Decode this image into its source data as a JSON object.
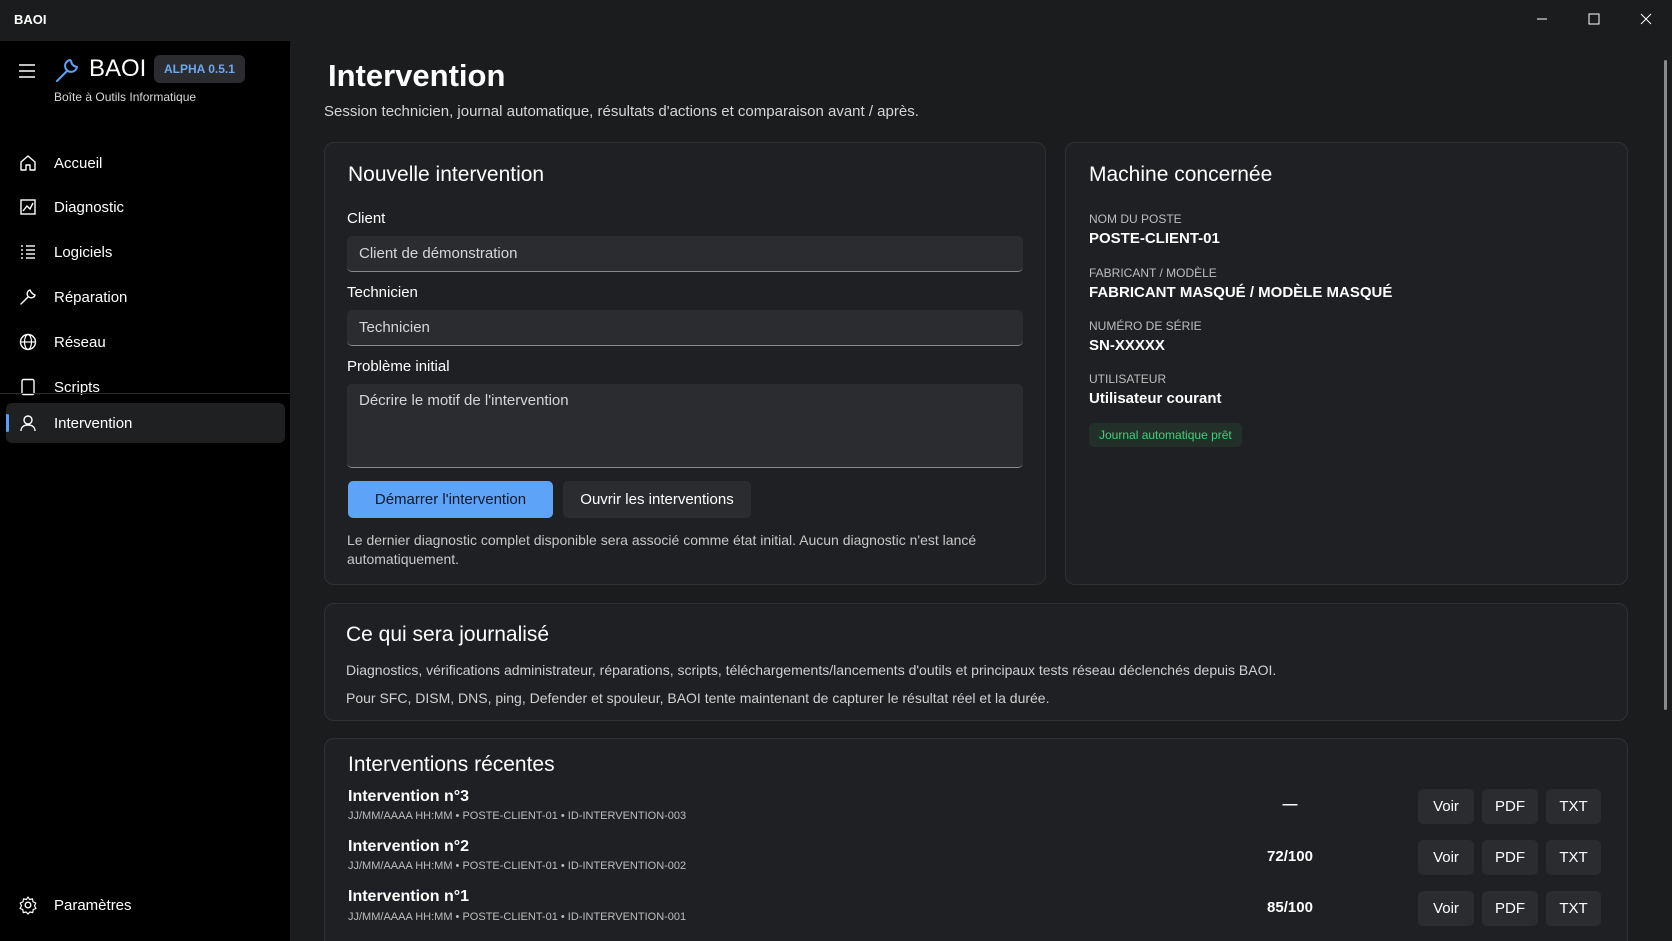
{
  "window": {
    "title": "BAOI"
  },
  "sidebar": {
    "brand": "BAOI",
    "version_badge": "ALPHA 0.5.1",
    "subtitle": "Boîte à Outils Informatique",
    "items": [
      {
        "label": "Accueil",
        "icon": "home-icon"
      },
      {
        "label": "Diagnostic",
        "icon": "chart-icon"
      },
      {
        "label": "Logiciels",
        "icon": "list-icon"
      },
      {
        "label": "Réparation",
        "icon": "wrench-icon"
      },
      {
        "label": "Réseau",
        "icon": "globe-icon"
      },
      {
        "label": "Scripts",
        "icon": "script-icon"
      },
      {
        "label": "Intervention",
        "icon": "user-icon",
        "active": true
      }
    ],
    "settings_label": "Paramètres"
  },
  "header": {
    "title": "Intervention",
    "subtitle": "Session technicien, journal automatique, résultats d'actions et comparaison avant / après."
  },
  "new_intervention": {
    "title": "Nouvelle intervention",
    "client_label": "Client",
    "client_value": "Client de démonstration",
    "technician_label": "Technicien",
    "technician_value": "Technicien",
    "problem_label": "Problème initial",
    "problem_placeholder": "Décrire le motif de l'intervention",
    "start_button": "Démarrer l'intervention",
    "open_button": "Ouvrir les interventions",
    "note": "Le dernier diagnostic complet disponible sera associé comme état initial. Aucun diagnostic n'est lancé automatiquement."
  },
  "machine": {
    "title": "Machine concernée",
    "hostname_label": "NOM DU POSTE",
    "hostname": "POSTE-CLIENT-01",
    "model_label": "FABRICANT / MODÈLE",
    "model": "FABRICANT MASQUÉ / MODÈLE MASQUÉ",
    "serial_label": "NUMÉRO DE SÉRIE",
    "serial": "SN-XXXXX",
    "user_label": "UTILISATEUR",
    "user": "Utilisateur courant",
    "status": "Journal automatique prêt",
    "status_color": "#3fcf7a"
  },
  "logging": {
    "title": "Ce qui sera journalisé",
    "line1": "Diagnostics, vérifications administrateur, réparations, scripts, téléchargements/lancements d'outils et principaux tests réseau déclenchés depuis BAOI.",
    "line2": "Pour SFC, DISM, DNS, ping, Defender et spouleur, BAOI tente maintenant de capturer le résultat réel et la durée."
  },
  "recent": {
    "title": "Interventions récentes",
    "rows": [
      {
        "title": "Intervention n°3",
        "meta": "JJ/MM/AAAA HH:MM • POSTE-CLIENT-01 • ID-INTERVENTION-003",
        "score": "—",
        "view": "Voir",
        "pdf": "PDF",
        "txt": "TXT"
      },
      {
        "title": "Intervention n°2",
        "meta": "JJ/MM/AAAA HH:MM • POSTE-CLIENT-01 • ID-INTERVENTION-002",
        "score": "72/100",
        "view": "Voir",
        "pdf": "PDF",
        "txt": "TXT"
      },
      {
        "title": "Intervention n°1",
        "meta": "JJ/MM/AAAA HH:MM • POSTE-CLIENT-01 • ID-INTERVENTION-001",
        "score": "85/100",
        "view": "Voir",
        "pdf": "PDF",
        "txt": "TXT"
      }
    ]
  },
  "colors": {
    "accent": "#5da3f7",
    "sidebar_bg": "#000000",
    "main_bg": "#1b1c1e"
  }
}
